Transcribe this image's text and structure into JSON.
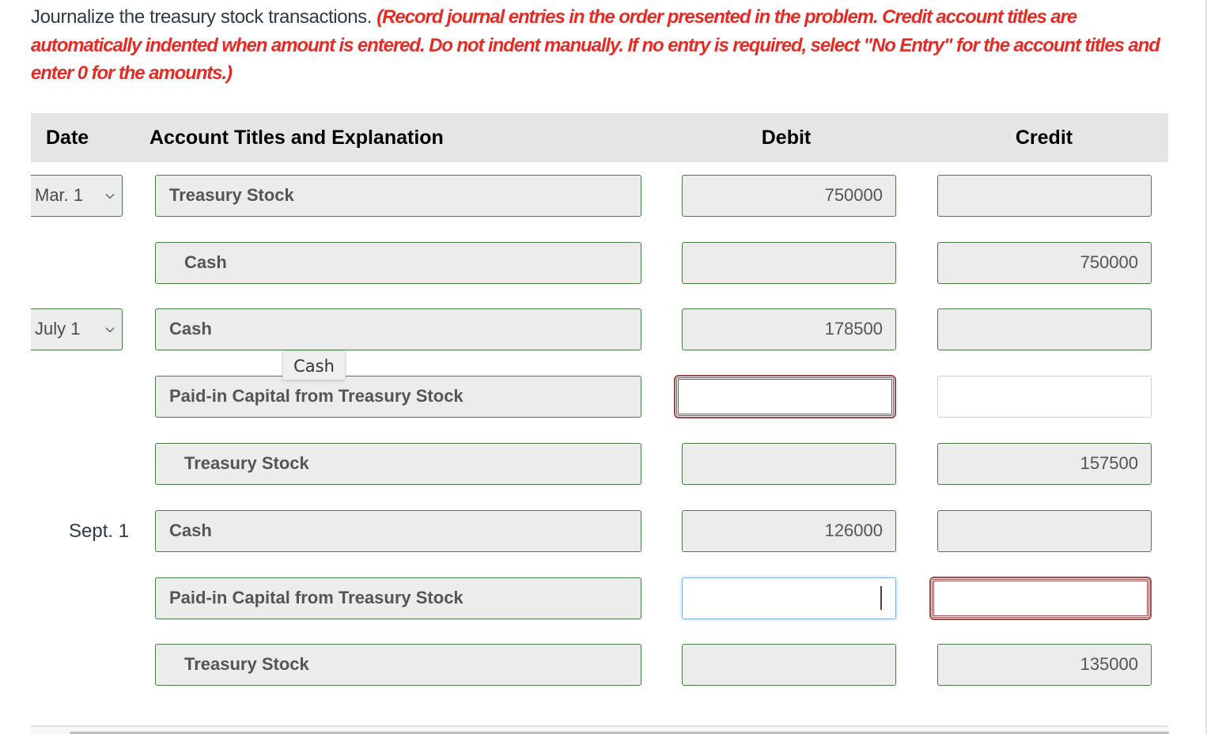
{
  "instructions": {
    "prompt": "Journalize the treasury stock transactions. ",
    "note": "(Record journal entries in the order presented in the problem. Credit account titles are automatically indented when amount is entered. Do not indent manually. If no entry is required, select \"No Entry\" for the account titles and enter 0 for the amounts.)"
  },
  "table": {
    "headers": {
      "date": "Date",
      "account": "Account Titles and Explanation",
      "debit": "Debit",
      "credit": "Credit"
    },
    "rows": [
      {
        "date": "Mar. 1",
        "date_type": "select",
        "account": "Treasury Stock",
        "indent": false,
        "debit": "750000",
        "credit": ""
      },
      {
        "date": "",
        "date_type": "none",
        "account": "Cash",
        "indent": true,
        "debit": "",
        "credit": "750000"
      },
      {
        "date": "July 1",
        "date_type": "select",
        "account": "Cash",
        "indent": false,
        "debit": "178500",
        "credit": ""
      },
      {
        "date": "",
        "date_type": "none",
        "account": "Paid-in Capital from Treasury Stock",
        "indent": false,
        "debit": "",
        "debit_state": "error",
        "credit": "",
        "credit_state": "blank"
      },
      {
        "date": "",
        "date_type": "none",
        "account": "Treasury Stock",
        "indent": true,
        "debit": "",
        "credit": "157500"
      },
      {
        "date": "Sept. 1",
        "date_type": "static",
        "account": "Cash",
        "indent": false,
        "debit": "126000",
        "credit": ""
      },
      {
        "date": "",
        "date_type": "none",
        "account": "Paid-in Capital from Treasury Stock",
        "indent": false,
        "debit": "",
        "debit_state": "focused",
        "credit": "",
        "credit_state": "error"
      },
      {
        "date": "",
        "date_type": "none",
        "account": "Treasury Stock",
        "indent": true,
        "debit": "",
        "credit": "135000"
      }
    ]
  },
  "tooltip": {
    "text": "Cash"
  },
  "colors": {
    "instruction_red": "#e42b25",
    "field_border_green": "#4a7a45",
    "error_border": "#9c4a47",
    "focus_border": "#7fb0e8",
    "header_bg": "#e5e5e5"
  }
}
